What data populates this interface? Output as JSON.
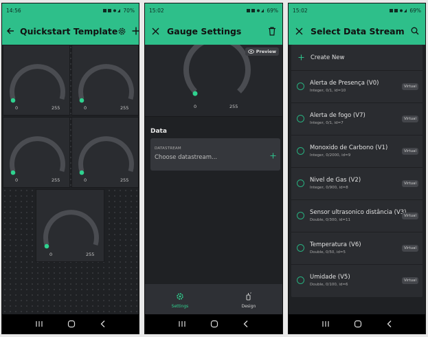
{
  "colors": {
    "accent": "#2ebf8a",
    "gauge_track": "#4a4c51",
    "gauge_dot": "#2fd28f",
    "panel": "#2a2c30",
    "background": "#1f2124"
  },
  "screen1": {
    "status": {
      "time": "14:56",
      "battery": "70%"
    },
    "title": "Quickstart Template",
    "icons": {
      "back": "arrow-left-icon",
      "settings": "gear-icon",
      "add": "plus-icon"
    },
    "gauges": [
      {
        "min": "0",
        "max": "255",
        "value": 0
      },
      {
        "min": "0",
        "max": "255",
        "value": 0
      },
      {
        "min": "0",
        "max": "255",
        "value": 0
      },
      {
        "min": "0",
        "max": "255",
        "value": 0
      },
      {
        "min": "0",
        "max": "255",
        "value": 0
      }
    ]
  },
  "screen2": {
    "status": {
      "time": "15:02",
      "battery": "69%"
    },
    "title": "Gauge Settings",
    "icons": {
      "close": "close-icon",
      "delete": "trash-icon",
      "preview": "eye-icon"
    },
    "preview_label": "Preview",
    "gauge": {
      "min": "0",
      "max": "255",
      "value": 0
    },
    "section_data": "Data",
    "datastream": {
      "caption": "DATASTREAM",
      "placeholder": "Choose datastream..."
    },
    "tabs": [
      {
        "label": "Settings",
        "icon": "gear-icon",
        "active": true
      },
      {
        "label": "Design",
        "icon": "brush-icon",
        "active": false
      }
    ]
  },
  "screen3": {
    "status": {
      "time": "15:02",
      "battery": "69%"
    },
    "title": "Select Data Stream",
    "icons": {
      "close": "close-icon",
      "search": "search-icon",
      "add": "plus-icon"
    },
    "create_new": "Create New",
    "streams": [
      {
        "name": "Alerta de Presença (V0)",
        "meta": "Integer, 0/1, id=10",
        "badge": "Virtual"
      },
      {
        "name": "Alerta de fogo (V7)",
        "meta": "Integer, 0/1, id=7",
        "badge": "Virtual"
      },
      {
        "name": "Monoxido de Carbono (V1)",
        "meta": "Integer, 0/2000, id=9",
        "badge": "Virtual"
      },
      {
        "name": "Nivel de Gas (V2)",
        "meta": "Integer, 0/900, id=8",
        "badge": "Virtual"
      },
      {
        "name": "Sensor ultrasonico distância (V3)",
        "meta": "Double, 0/300, id=11",
        "badge": "Virtual"
      },
      {
        "name": "Temperatura (V6)",
        "meta": "Double, 0/50, id=5",
        "badge": "Virtual"
      },
      {
        "name": "Umidade (V5)",
        "meta": "Double, 0/100, id=6",
        "badge": "Virtual"
      }
    ]
  },
  "navbar": {
    "icons": [
      "recent-apps-icon",
      "home-icon",
      "back-icon"
    ]
  }
}
